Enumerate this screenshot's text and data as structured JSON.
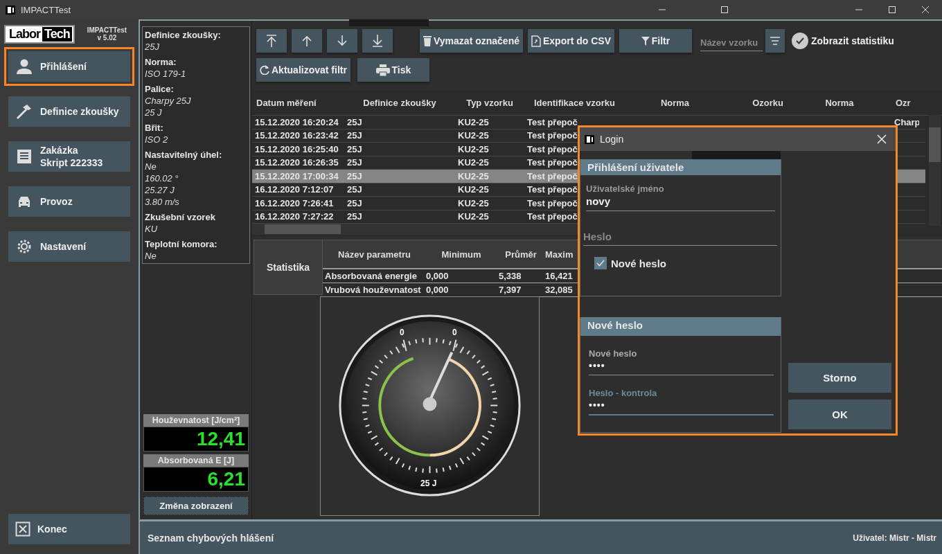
{
  "window": {
    "title": "IMPACTTest"
  },
  "app": {
    "name": "IMPACTTest",
    "version": "v 5.02"
  },
  "logo": {
    "word_1": "Labor",
    "word_2": "Tech"
  },
  "nav": [
    {
      "label": "Přihlášení",
      "highlighted": true
    },
    {
      "label": "Definice zkoušky",
      "highlighted": false
    },
    {
      "label": "Zakázka",
      "sublabel": "Skript 222333",
      "highlighted": false
    },
    {
      "label": "Provoz",
      "highlighted": false
    },
    {
      "label": "Nastavení",
      "highlighted": false
    }
  ],
  "exit_button": {
    "label": "Konec"
  },
  "test_info": [
    {
      "label": "Definice zkoušky:",
      "values": [
        "25J"
      ]
    },
    {
      "label": "Norma:",
      "values": [
        "ISO 179-1"
      ]
    },
    {
      "label": "Palice:",
      "values": [
        "Charpy 25J",
        "25 J"
      ]
    },
    {
      "label": "Břit:",
      "values": [
        "ISO 2"
      ]
    },
    {
      "label": "Nastavitelný úhel:",
      "values": [
        "Ne",
        "160.02 °",
        "25.27 J",
        "3.80 m/s"
      ]
    },
    {
      "label": "Zkušební vzorek",
      "values": [
        "KU"
      ]
    },
    {
      "label": "Teplotní komora:",
      "values": [
        "Ne"
      ]
    }
  ],
  "readouts": [
    {
      "label": "Houževnatost [J/cm²]",
      "value": "12,41"
    },
    {
      "label": "Absorbovaná E [J]",
      "value": "6,21"
    }
  ],
  "view_button": {
    "label": "Změna zobrazení"
  },
  "toolbar": {
    "delete_button": "Vymazat označené",
    "export_button": "Export do CSV",
    "filter_button": "Filtr",
    "sample_name_field": {
      "placeholder": "Název vzorku"
    },
    "show_statistics": {
      "label": "Zobrazit statistiku",
      "checked": true
    },
    "refresh_button": "Aktualizovat filtr",
    "print_button": "Tisk"
  },
  "table": {
    "columns": [
      "Datum měření",
      "Definice zkoušky",
      "Typ vzorku",
      "Identifikace vzorku",
      "Norma",
      "Ozorku",
      "Norma",
      "Ozr"
    ],
    "rows": [
      {
        "cells": [
          "15.12.2020 16:20:24",
          "25J",
          "KU2-25",
          "Test přepoč",
          "",
          "",
          "",
          "Charp"
        ],
        "selected": false
      },
      {
        "cells": [
          "15.12.2020 16:23:42",
          "25J",
          "KU2-25",
          "Test přepoč",
          "",
          "",
          "",
          ""
        ],
        "selected": false
      },
      {
        "cells": [
          "15.12.2020 16:25:40",
          "25J",
          "KU2-25",
          "Test přepoč",
          "",
          "",
          "",
          ""
        ],
        "selected": false
      },
      {
        "cells": [
          "15.12.2020 16:26:35",
          "25J",
          "KU2-25",
          "Test přepoč",
          "",
          "",
          "",
          ""
        ],
        "selected": false
      },
      {
        "cells": [
          "15.12.2020 17:00:34",
          "25J",
          "KU2-25",
          "Test přepoč",
          "",
          "",
          "",
          ""
        ],
        "selected": true
      },
      {
        "cells": [
          "16.12.2020 7:12:07",
          "25J",
          "KU2-25",
          "Test přepoč",
          "",
          "",
          "",
          ""
        ],
        "selected": false
      },
      {
        "cells": [
          "16.12.2020 7:26:41",
          "25J",
          "KU2-25",
          "Test přepoč",
          "",
          "",
          "",
          ""
        ],
        "selected": false
      },
      {
        "cells": [
          "16.12.2020 7:27:22",
          "25J",
          "KU2-25",
          "Test přepoč",
          "",
          "",
          "",
          ""
        ],
        "selected": false
      }
    ]
  },
  "statistics": {
    "title": "Statistika",
    "columns": [
      "Název parametru",
      "Minimum",
      "Průměr",
      "Maxim"
    ],
    "rows": [
      [
        "Absorbovaná energie",
        "0,000",
        "5,338",
        "16,421"
      ],
      [
        "Vrubová houževnatost",
        "0,000",
        "7,397",
        "32,085"
      ]
    ]
  },
  "gauge": {
    "drag_labels": [
      "0",
      "0"
    ],
    "range_label": "25 J"
  },
  "status_bar": {
    "message": "Seznam chybových hlášení",
    "user": "Uživatel: Mistr - Mistr"
  },
  "dialog": {
    "title": "Login",
    "login_section": {
      "title": "Přihlášení uživatele",
      "username": {
        "label": "Uživatelské jméno",
        "value": "novy"
      },
      "password": {
        "placeholder": "Heslo"
      },
      "new_password": {
        "label": "Nové heslo",
        "checked": true
      }
    },
    "new_password_section": {
      "title": "Nové heslo",
      "fields": [
        {
          "label": "Nové heslo",
          "value": "••••",
          "focused": false
        },
        {
          "label": "Heslo - kontrola",
          "value": "••••",
          "focused": true
        }
      ]
    },
    "buttons": [
      "Storno",
      "OK"
    ]
  }
}
